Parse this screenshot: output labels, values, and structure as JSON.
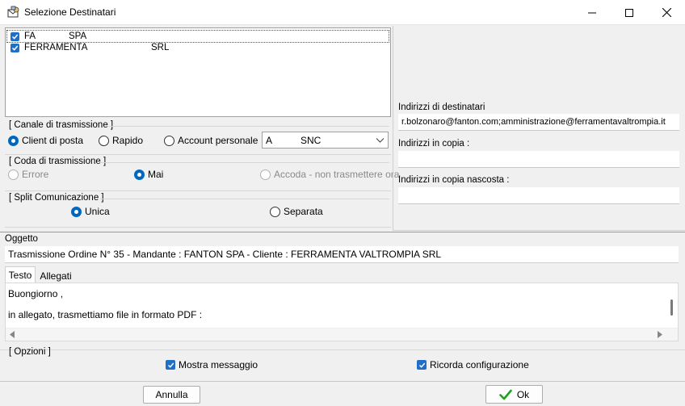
{
  "window": {
    "title": "Selezione Destinatari",
    "app_icon": "users-mail-icon",
    "controls": [
      "minimize-icon",
      "maximize-icon",
      "close-icon"
    ]
  },
  "recipients": [
    {
      "checked": true,
      "name_left": "FA",
      "name_right": "SPA"
    },
    {
      "checked": true,
      "name_left": "FERRAMENTA",
      "name_right": "SRL"
    }
  ],
  "canale": {
    "label": "[ Canale di trasmissione ]",
    "options": [
      "Client di posta",
      "Rapido",
      "Account personale"
    ],
    "selected": "Client di posta",
    "account": {
      "left": "A",
      "right": "SNC"
    }
  },
  "coda": {
    "label": "[ Coda di trasmissione ]",
    "options": [
      "Errore",
      "Mai",
      "Accoda - non trasmettere ora"
    ],
    "selected": "Mai"
  },
  "split": {
    "label": "[ Split Comunicazione ]",
    "options": [
      "Unica",
      "Separata"
    ],
    "selected": "Unica"
  },
  "addresses": {
    "to_label": "Indirizzi di destinatari",
    "to_value": "r.bolzonaro@fanton.com;amministrazione@ferramentavaltrompia.it",
    "cc_label": "Indirizzi in copia :",
    "cc_value": "",
    "bcc_label": "Indirizzi in copia nascosta :",
    "bcc_value": ""
  },
  "subject": {
    "label": "Oggetto",
    "value": "Trasmissione Ordine N° 35 - Mandante : FANTON SPA - Cliente : FERRAMENTA VALTROMPIA SRL"
  },
  "tabs": [
    "Testo",
    "Allegati"
  ],
  "active_tab": "Testo",
  "message": {
    "line1": "Buongiorno ,",
    "line2": "in allegato, trasmettiamo file in formato PDF :"
  },
  "options": {
    "label": "[ Opzioni ]",
    "show_message_label": "Mostra messaggio",
    "show_message_checked": true,
    "remember_label": "Ricorda configurazione",
    "remember_checked": true
  },
  "buttons": {
    "cancel": "Annulla",
    "ok": "Ok",
    "accent": "#0067c0",
    "ok_icon_color": "#19a51b"
  }
}
